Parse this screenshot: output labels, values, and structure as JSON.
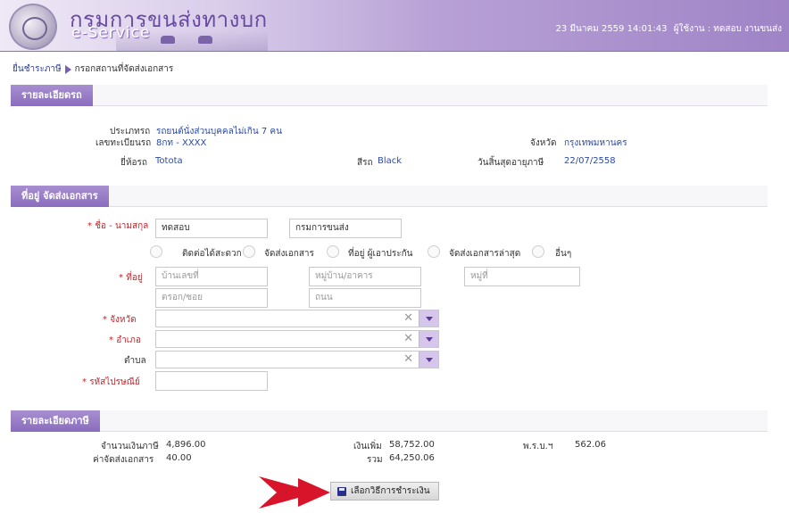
{
  "header": {
    "brand_th": "กรมการขนส่งทางบก",
    "brand_en": "e-Service",
    "datetime": "23 มีนาคม 2559 14:01:43",
    "user_label": "ผู้ใช้งาน : ทดสอบ  งานขนส่ง",
    "colors": {
      "accent": "#8a6cbd",
      "header_end": "#9f84c6"
    }
  },
  "breadcrumb": {
    "item1": "ยื่นชำระภาษี",
    "item2": "กรอกสถานที่จัดส่งเอกสาร"
  },
  "car_section": {
    "title": "รายละเอียดรถ",
    "type_label": "ประเภทรถ",
    "type_value": "รถยนต์นั่งส่วนบุคคลไม่เกิน 7 คน",
    "plate_label": "เลขทะเบียนรถ",
    "plate_value": "8กท - XXXX",
    "province_label": "จังหวัด",
    "province_value": "กรุงเทพมหานคร",
    "brand_label": "ยี่ห้อรถ",
    "brand_value": "Totota",
    "color_label": "สีรถ",
    "color_value": "Black",
    "expire_label": "วันสิ้นสุดอายุภาษี",
    "expire_value": "22/07/2558"
  },
  "address_section": {
    "title": "ที่อยู่ จัดส่งเอกสาร",
    "name_label": "ชื่อ - นามสกุล",
    "first_name": "ทดสอบ",
    "last_name": "กรมการขนส่ง",
    "radio_options": [
      "ติดต่อได้สะดวก",
      "จัดส่งเอกสาร",
      "ที่อยู่ ผู้เอาประกัน",
      "จัดส่งเอกสารล่าสุด",
      "อื่นๆ"
    ],
    "address_label": "ที่อยู่",
    "house_placeholder": "บ้านเลขที่",
    "village_placeholder": "หมู่บ้าน/อาคาร",
    "moo_placeholder": "หมู่ที่",
    "soi_placeholder": "ตรอก/ซอย",
    "road_placeholder": "ถนน",
    "province_label": "จังหวัด",
    "district_label": "อำเภอ",
    "subdistrict_label": "ตำบล",
    "postal_label": "รหัสไปรษณีย์"
  },
  "tax_section": {
    "title": "รายละเอียดภาษี",
    "tax_amount_label": "จำนวนเงินภาษี",
    "tax_amount_value": "4,896.00",
    "delivery_label": "ค่าจัดส่งเอกสาร",
    "delivery_value": "40.00",
    "surcharge_label": "เงินเพิ่ม",
    "surcharge_value": "58,752.00",
    "total_label": "รวม",
    "total_value": "64,250.06",
    "act_label": "พ.ร.บ.ฯ",
    "act_value": "562.06"
  },
  "pay_button": "เลือกวิธีการชำระเงิน"
}
